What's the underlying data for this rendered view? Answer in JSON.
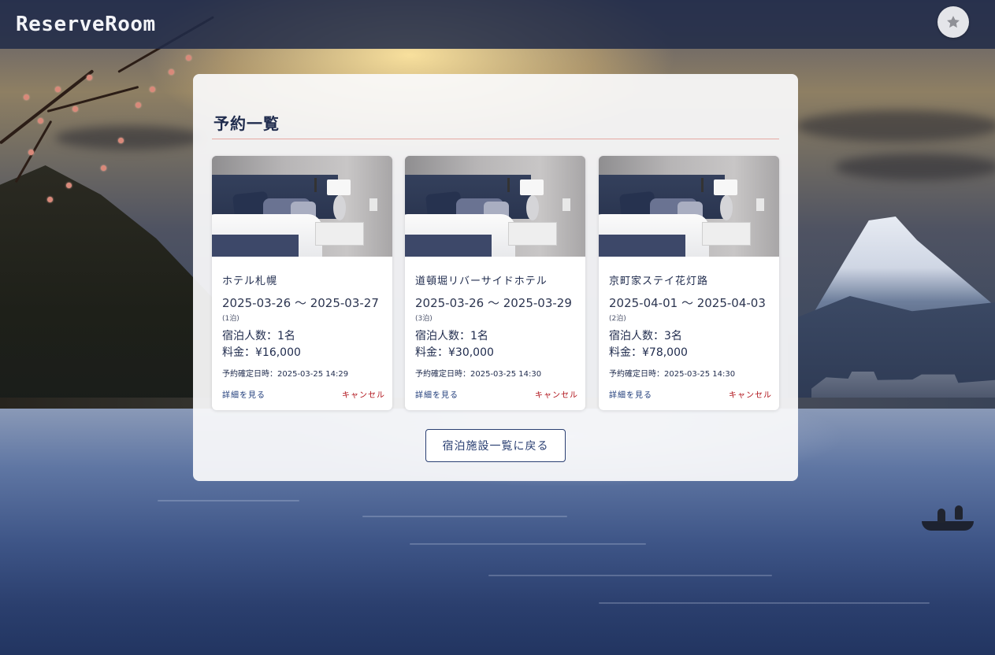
{
  "header": {
    "brand": "ReserveRoom",
    "favorite_icon": "star-icon"
  },
  "main": {
    "title": "予約一覧",
    "reservations": [
      {
        "hotel_name": "ホテル札幌",
        "dates": "2025-03-26 〜 2025-03-27",
        "nights": "(1泊)",
        "guests": "宿泊人数：1名",
        "price": "料金：¥16,000",
        "booked_at": "予約確定日時：2025-03-25 14:29",
        "detail_label": "詳細を見る",
        "cancel_label": "キャンセル"
      },
      {
        "hotel_name": "道頓堀リバーサイドホテル",
        "dates": "2025-03-26 〜 2025-03-29",
        "nights": "(3泊)",
        "guests": "宿泊人数：1名",
        "price": "料金：¥30,000",
        "booked_at": "予約確定日時：2025-03-25 14:30",
        "detail_label": "詳細を見る",
        "cancel_label": "キャンセル"
      },
      {
        "hotel_name": "京町家ステイ花灯路",
        "dates": "2025-04-01 〜 2025-04-03",
        "nights": "(2泊)",
        "guests": "宿泊人数：3名",
        "price": "料金：¥78,000",
        "booked_at": "予約確定日時：2025-03-25 14:30",
        "detail_label": "詳細を見る",
        "cancel_label": "キャンセル"
      }
    ],
    "back_label": "宿泊施設一覧に戻る"
  },
  "colors": {
    "header_bg": "#212b48",
    "primary": "#1f2b4d",
    "link": "#1f3c7a",
    "cancel": "#b0121a",
    "title_rule": "#e6a9a2"
  }
}
